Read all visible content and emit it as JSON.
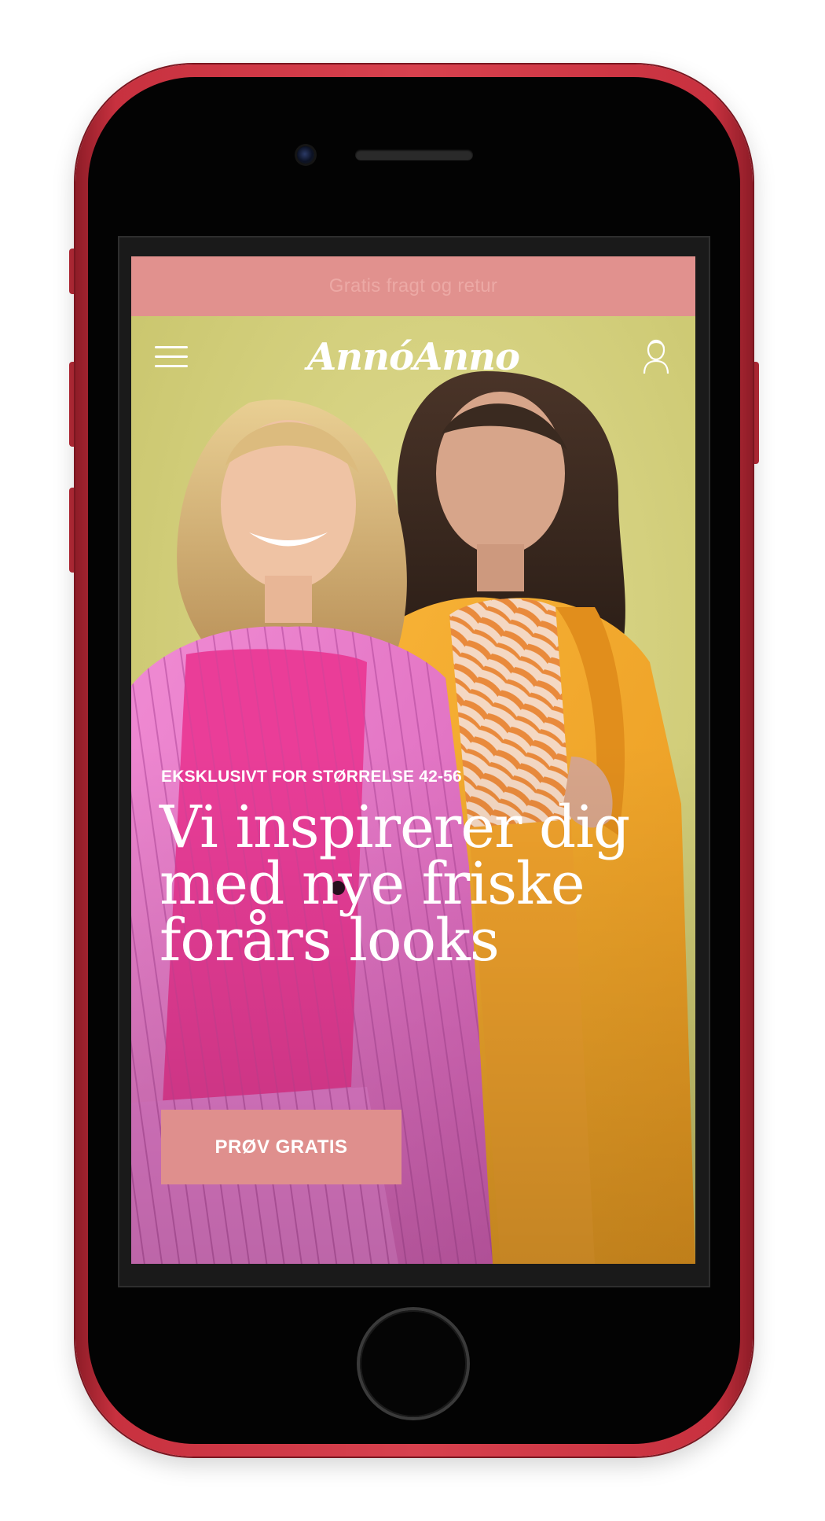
{
  "promo": {
    "text": "Gratis fragt og retur"
  },
  "header": {
    "logo": "AnnóAnno",
    "menu_icon": "hamburger-menu-icon",
    "account_icon": "user-account-icon"
  },
  "hero": {
    "eyebrow": "EKSKLUSIVT FOR STØRRELSE 42-56",
    "headline": [
      "Vi inspirerer dig",
      "med nye friske",
      "forårs looks"
    ],
    "cta_label": "PRØV GRATIS"
  },
  "colors": {
    "phone_body": "#d7414e",
    "promo_bar": "#e1918e",
    "hero_background": "#d5d07a",
    "cta_background": "#df8f8d"
  }
}
